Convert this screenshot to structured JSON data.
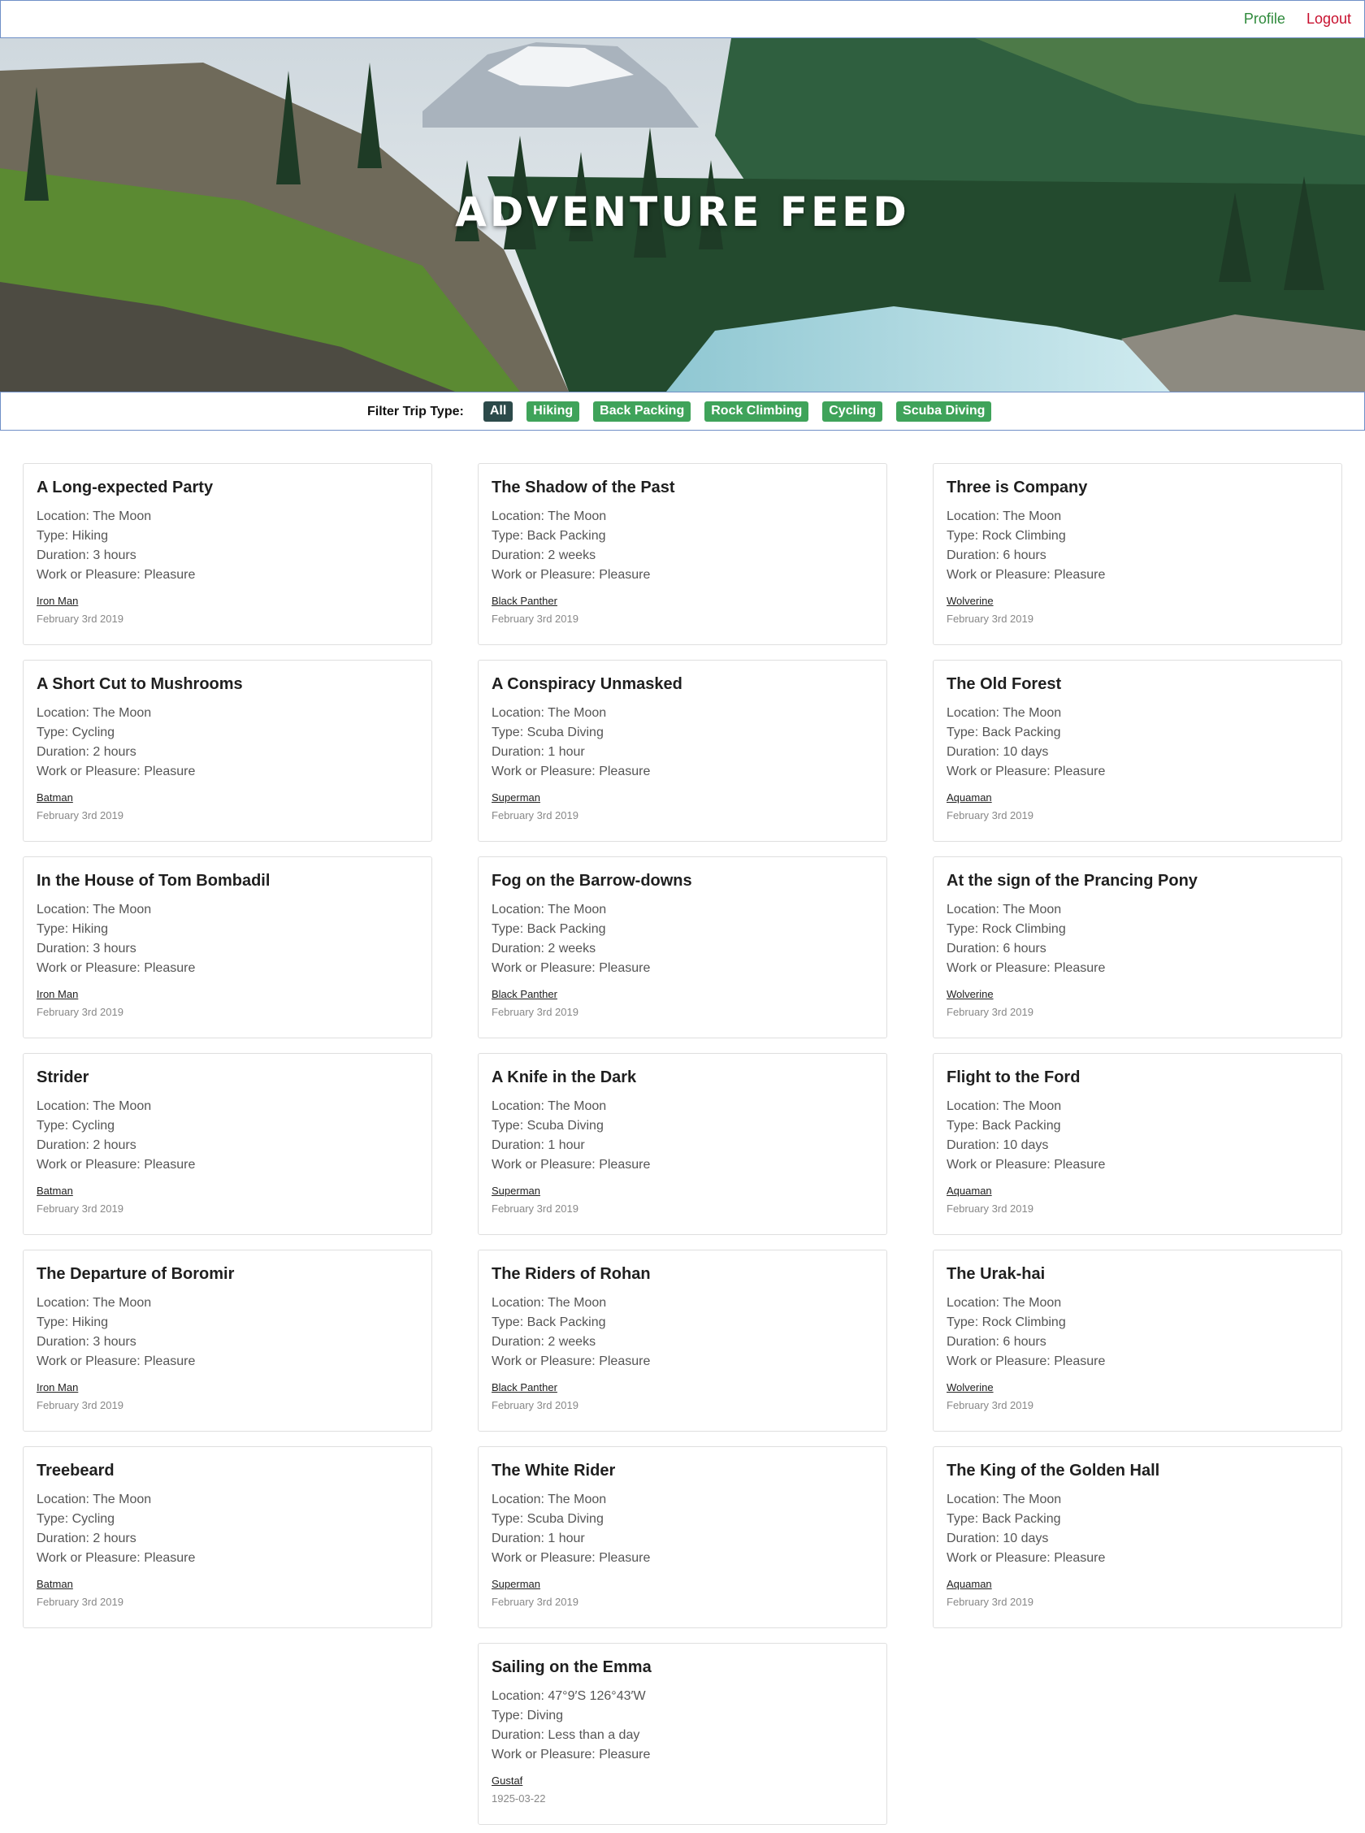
{
  "nav": {
    "profile": "Profile",
    "logout": "Logout"
  },
  "hero": {
    "title": "ADVENTURE FEED"
  },
  "filter": {
    "label": "Filter Trip Type:",
    "options": [
      "All",
      "Hiking",
      "Back Packing",
      "Rock Climbing",
      "Cycling",
      "Scuba Diving"
    ],
    "active": "All"
  },
  "colors": {
    "accent_green": "#3fa35a",
    "active_chip": "#2c4a4a",
    "logout_red": "#c8102e",
    "profile_green": "#2f8a3c"
  },
  "trips": [
    {
      "title": "A Long-expected Party",
      "location": "Location: The Moon",
      "type": "Type: Hiking",
      "duration": "Duration: 3 hours",
      "purpose": "Work or Pleasure: Pleasure",
      "author": "Iron Man",
      "date": "February 3rd 2019"
    },
    {
      "title": "The Shadow of the Past",
      "location": "Location: The Moon",
      "type": "Type: Back Packing",
      "duration": "Duration: 2 weeks",
      "purpose": "Work or Pleasure: Pleasure",
      "author": "Black Panther",
      "date": "February 3rd 2019"
    },
    {
      "title": "Three is Company",
      "location": "Location: The Moon",
      "type": "Type: Rock Climbing",
      "duration": "Duration: 6 hours",
      "purpose": "Work or Pleasure: Pleasure",
      "author": "Wolverine",
      "date": "February 3rd 2019"
    },
    {
      "title": "A Short Cut to Mushrooms",
      "location": "Location: The Moon",
      "type": "Type: Cycling",
      "duration": "Duration: 2 hours",
      "purpose": "Work or Pleasure: Pleasure",
      "author": "Batman",
      "date": "February 3rd 2019"
    },
    {
      "title": "A Conspiracy Unmasked",
      "location": "Location: The Moon",
      "type": "Type: Scuba Diving",
      "duration": "Duration: 1 hour",
      "purpose": "Work or Pleasure: Pleasure",
      "author": "Superman",
      "date": "February 3rd 2019"
    },
    {
      "title": "The Old Forest",
      "location": "Location: The Moon",
      "type": "Type: Back Packing",
      "duration": "Duration: 10 days",
      "purpose": "Work or Pleasure: Pleasure",
      "author": "Aquaman",
      "date": "February 3rd 2019"
    },
    {
      "title": "In the House of Tom Bombadil",
      "location": "Location: The Moon",
      "type": "Type: Hiking",
      "duration": "Duration: 3 hours",
      "purpose": "Work or Pleasure: Pleasure",
      "author": "Iron Man",
      "date": "February 3rd 2019"
    },
    {
      "title": "Fog on the Barrow-downs",
      "location": "Location: The Moon",
      "type": "Type: Back Packing",
      "duration": "Duration: 2 weeks",
      "purpose": "Work or Pleasure: Pleasure",
      "author": "Black Panther",
      "date": "February 3rd 2019"
    },
    {
      "title": "At the sign of the Prancing Pony",
      "location": "Location: The Moon",
      "type": "Type: Rock Climbing",
      "duration": "Duration: 6 hours",
      "purpose": "Work or Pleasure: Pleasure",
      "author": "Wolverine",
      "date": "February 3rd 2019"
    },
    {
      "title": "Strider",
      "location": "Location: The Moon",
      "type": "Type: Cycling",
      "duration": "Duration: 2 hours",
      "purpose": "Work or Pleasure: Pleasure",
      "author": "Batman",
      "date": "February 3rd 2019"
    },
    {
      "title": "A Knife in the Dark",
      "location": "Location: The Moon",
      "type": "Type: Scuba Diving",
      "duration": "Duration: 1 hour",
      "purpose": "Work or Pleasure: Pleasure",
      "author": "Superman",
      "date": "February 3rd 2019"
    },
    {
      "title": "Flight to the Ford",
      "location": "Location: The Moon",
      "type": "Type: Back Packing",
      "duration": "Duration: 10 days",
      "purpose": "Work or Pleasure: Pleasure",
      "author": "Aquaman",
      "date": "February 3rd 2019"
    },
    {
      "title": "The Departure of Boromir",
      "location": "Location: The Moon",
      "type": "Type: Hiking",
      "duration": "Duration: 3 hours",
      "purpose": "Work or Pleasure: Pleasure",
      "author": "Iron Man",
      "date": "February 3rd 2019"
    },
    {
      "title": "The Riders of Rohan",
      "location": "Location: The Moon",
      "type": "Type: Back Packing",
      "duration": "Duration: 2 weeks",
      "purpose": "Work or Pleasure: Pleasure",
      "author": "Black Panther",
      "date": "February 3rd 2019"
    },
    {
      "title": "The Urak-hai",
      "location": "Location: The Moon",
      "type": "Type: Rock Climbing",
      "duration": "Duration: 6 hours",
      "purpose": "Work or Pleasure: Pleasure",
      "author": "Wolverine",
      "date": "February 3rd 2019"
    },
    {
      "title": "Treebeard",
      "location": "Location: The Moon",
      "type": "Type: Cycling",
      "duration": "Duration: 2 hours",
      "purpose": "Work or Pleasure: Pleasure",
      "author": "Batman",
      "date": "February 3rd 2019"
    },
    {
      "title": "The White Rider",
      "location": "Location: The Moon",
      "type": "Type: Scuba Diving",
      "duration": "Duration: 1 hour",
      "purpose": "Work or Pleasure: Pleasure",
      "author": "Superman",
      "date": "February 3rd 2019"
    },
    {
      "title": "The King of the Golden Hall",
      "location": "Location: The Moon",
      "type": "Type: Back Packing",
      "duration": "Duration: 10 days",
      "purpose": "Work or Pleasure: Pleasure",
      "author": "Aquaman",
      "date": "February 3rd 2019"
    },
    {
      "title": "Sailing on the Emma",
      "location": "Location: 47°9′S 126°43′W",
      "type": "Type: Diving",
      "duration": "Duration: Less than a day",
      "purpose": "Work or Pleasure: Pleasure",
      "author": "Gustaf",
      "date": "1925-03-22"
    }
  ]
}
